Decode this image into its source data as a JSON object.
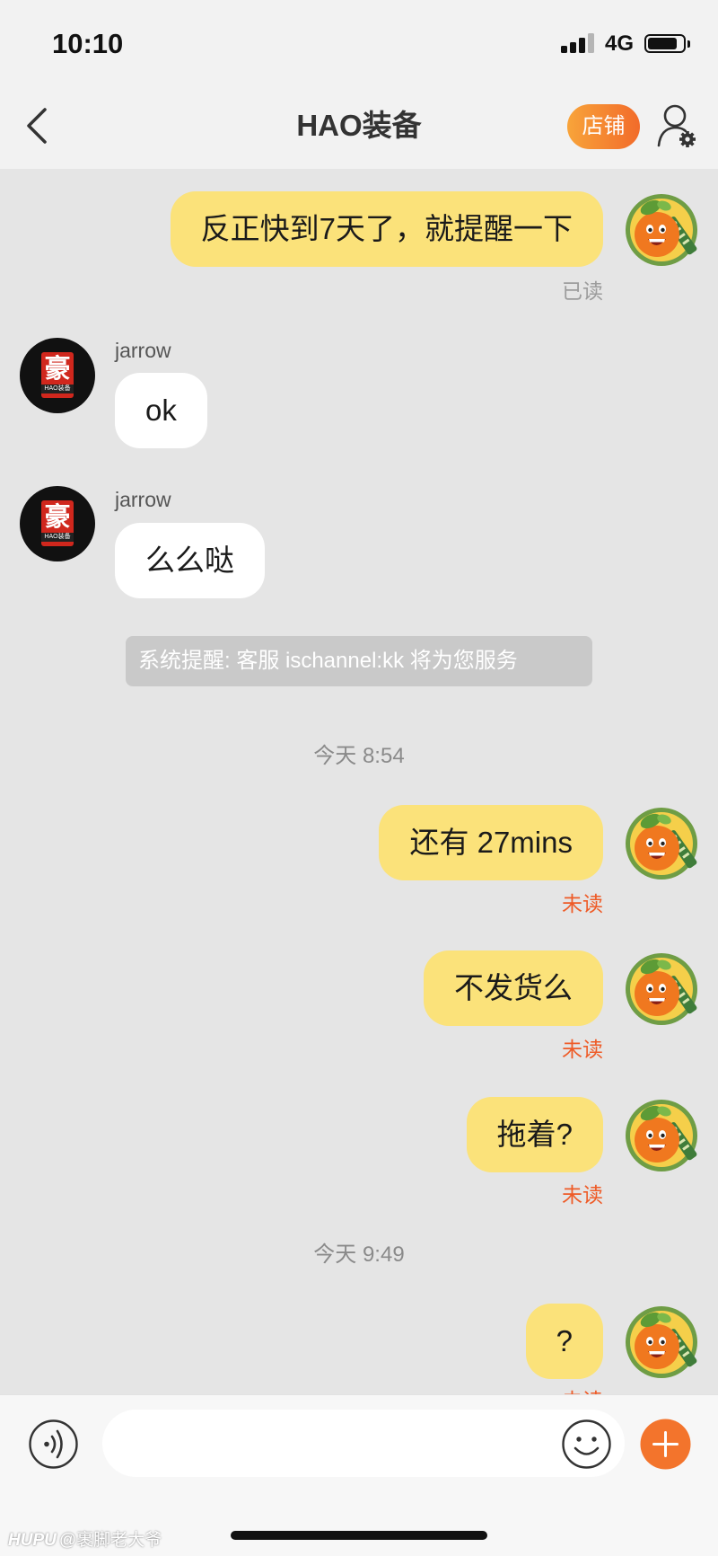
{
  "status_bar": {
    "time": "10:10",
    "network": "4G",
    "signal_icon": "signal-bars-icon",
    "signal_level": 3,
    "signal_max": 4,
    "battery_icon": "battery-icon",
    "battery_level": 0.85
  },
  "header": {
    "title": "HAO装备",
    "shop_button_label": "店铺",
    "back_icon": "chevron-left-icon",
    "profile_icon": "user-settings-icon"
  },
  "colors": {
    "header_bg": "#f2f2f2",
    "chat_bg": "#e5e5e5",
    "outgoing_bubble": "#fbe27a",
    "incoming_bubble": "#ffffff",
    "accent_orange": "#f26b2a",
    "read_status": "#9c9c9c",
    "unread_status": "#ee5b27",
    "system_notice_bg": "#c9c9c9"
  },
  "avatars": {
    "self": {
      "icon": "orange-cartoon-avatar-icon"
    },
    "shop": {
      "logo_char": "豪",
      "logo_text": "HAO装备"
    }
  },
  "messages": [
    {
      "text": "反正快到7天了，就提醒一下",
      "status": "已读"
    },
    {
      "sender": "jarrow",
      "text": "ok"
    },
    {
      "sender": "jarrow",
      "text": "么么哒"
    },
    {
      "system_notice": "系统提醒: 客服 ischannel:kk 将为您服务"
    },
    {
      "timestamp": "今天 8:54"
    },
    {
      "text": "还有 27mins",
      "status": "未读"
    },
    {
      "text": "不发货么",
      "status": "未读"
    },
    {
      "text": "拖着?",
      "status": "未读"
    },
    {
      "timestamp": "今天 9:49"
    },
    {
      "text": "?",
      "status": "未读"
    }
  ],
  "input_bar": {
    "message_value": "",
    "voice_icon": "voice-input-icon",
    "emoji_icon": "emoji-smiley-icon",
    "more_icon": "plus-icon"
  },
  "watermark": {
    "brand": "HUPU",
    "user": "@裹脚老大爷"
  }
}
